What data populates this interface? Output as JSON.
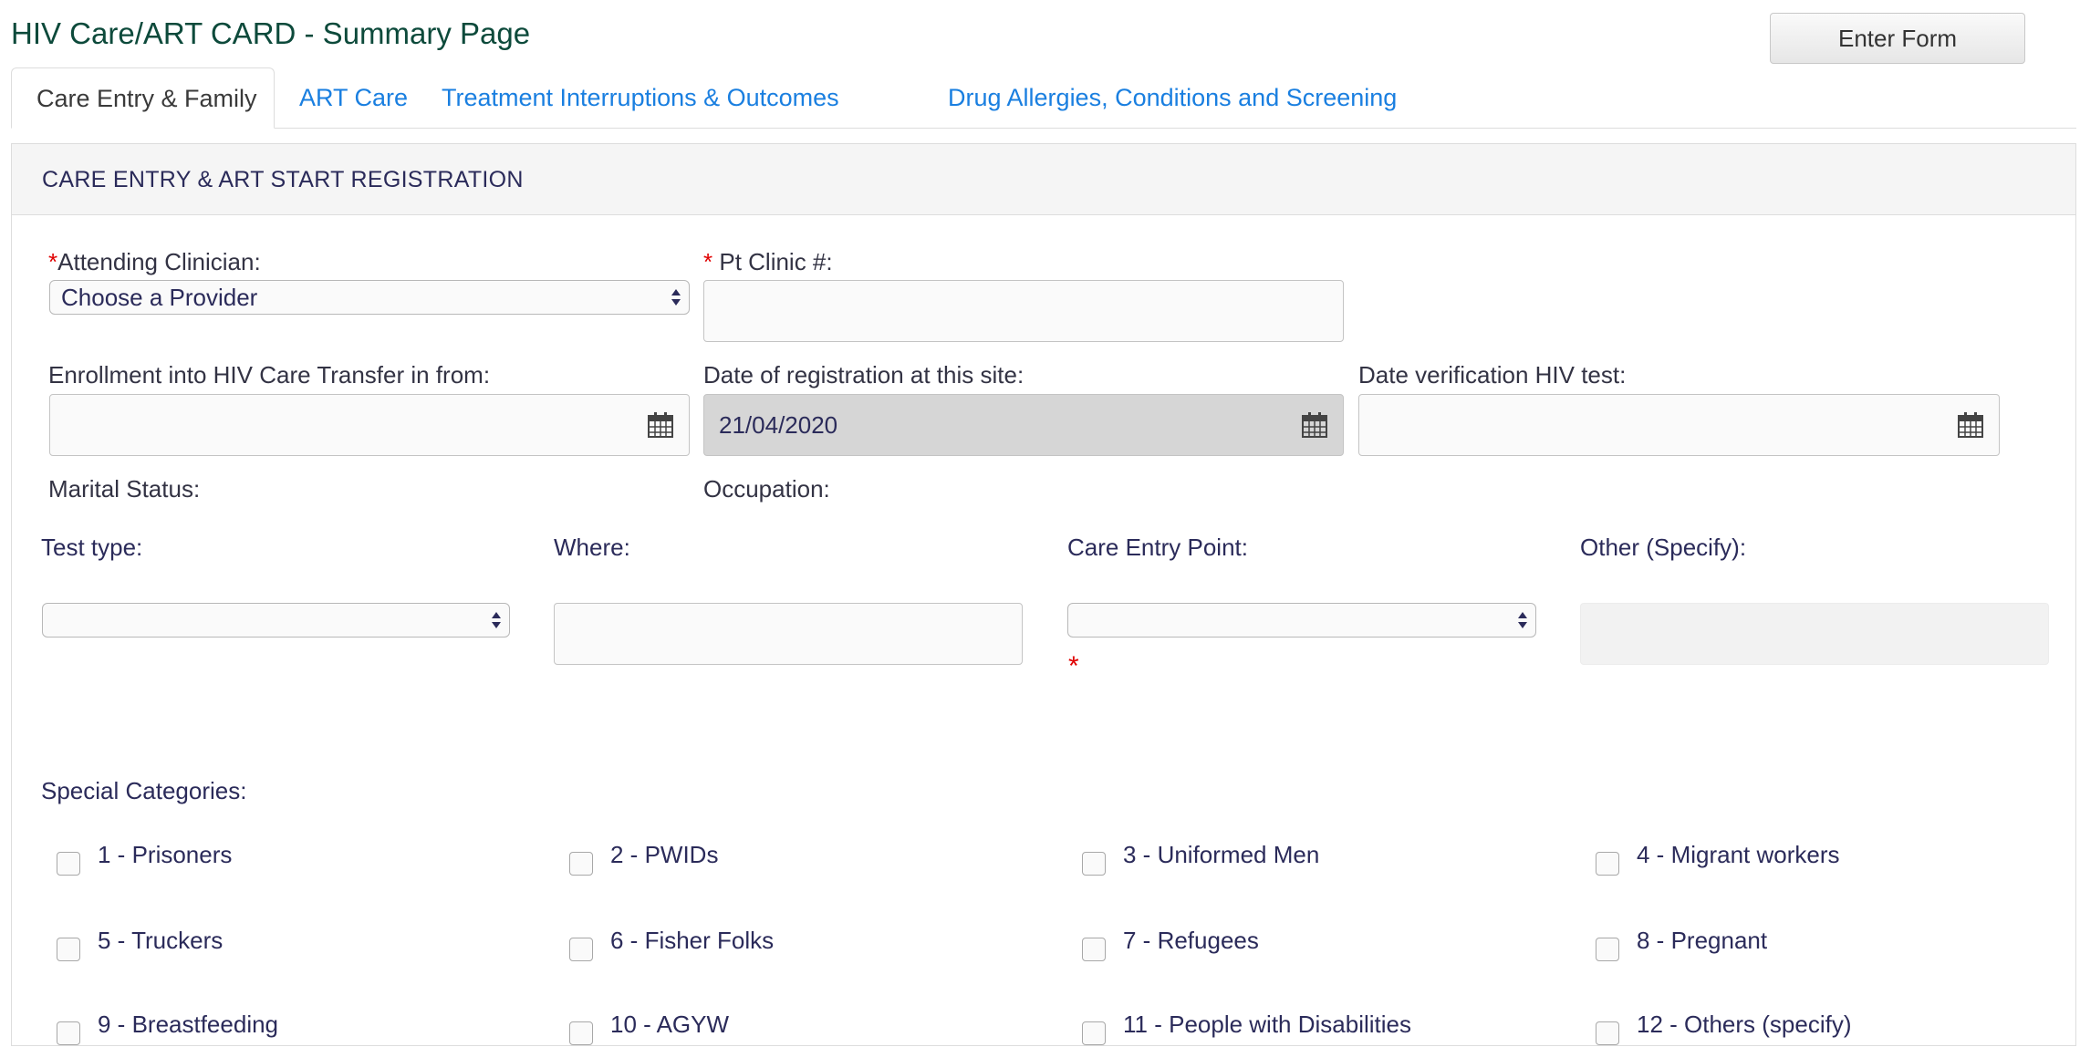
{
  "page": {
    "title": "HIV Care/ART CARD - Summary Page",
    "enter_form_label": "Enter Form"
  },
  "tabs": [
    {
      "label": "Care Entry & Family"
    },
    {
      "label": "ART Care"
    },
    {
      "label": "Treatment Interruptions & Outcomes"
    },
    {
      "label": "Drug Allergies, Conditions and Screening"
    }
  ],
  "section": {
    "title": "CARE ENTRY & ART START REGISTRATION"
  },
  "fields": {
    "attending_clinician": {
      "required": "*",
      "label": "Attending Clinician:",
      "value": "Choose a Provider"
    },
    "pt_clinic": {
      "required": "*",
      "label": " Pt Clinic #:",
      "value": ""
    },
    "enrollment_transfer": {
      "label": "Enrollment into HIV Care Transfer in from:",
      "value": ""
    },
    "date_registration": {
      "label": "Date of registration at this site:",
      "value": "21/04/2020"
    },
    "date_verification": {
      "label": "Date verification HIV test:",
      "value": ""
    },
    "marital_status": {
      "label": "Marital Status:"
    },
    "occupation": {
      "label": "Occupation:"
    },
    "test_type": {
      "label": "Test type:",
      "value": ""
    },
    "where": {
      "label": "Where:",
      "value": ""
    },
    "care_entry_point": {
      "label": "Care Entry Point:",
      "value": "",
      "required": "*"
    },
    "other_specify": {
      "label": "Other (Specify):",
      "value": ""
    }
  },
  "special_categories": {
    "label": "Special Categories:",
    "items": [
      "1 - Prisoners",
      "2 - PWIDs",
      "3 - Uniformed Men",
      "4 - Migrant workers",
      "5 - Truckers",
      "6 - Fisher Folks",
      "7 - Refugees",
      "8 - Pregnant",
      "9 - Breastfeeding",
      "10 - AGYW",
      "11 - People with Disabilities",
      "12 - Others (specify)"
    ]
  },
  "colors": {
    "title": "#0d4a3b",
    "tab_link": "#1a7fe0",
    "required": "#e00000",
    "text": "#2b2b5a"
  },
  "icons": {
    "calendar": "calendar-icon",
    "select_arrows": "select-arrows-icon"
  }
}
